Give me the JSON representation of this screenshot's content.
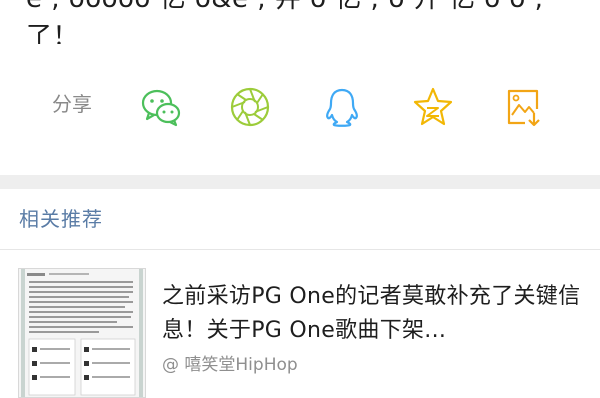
{
  "article_text": {
    "line1": "e , ooooo 亿 o&e , 井 o 亿 ; o 开 亿 o o ,",
    "line2": "了！"
  },
  "share": {
    "label": "分享",
    "buttons": [
      {
        "name": "wechat",
        "icon": "wechat-icon",
        "color": "#4cbf5b"
      },
      {
        "name": "moments",
        "icon": "moments-icon",
        "color": "#9ccc3a"
      },
      {
        "name": "qq",
        "icon": "qq-icon",
        "color": "#3fa9f5"
      },
      {
        "name": "qzone",
        "icon": "qzone-icon",
        "color": "#f2b705"
      },
      {
        "name": "save-image",
        "icon": "save-image-icon",
        "color": "#f2a515"
      }
    ]
  },
  "related": {
    "title": "相关推荐",
    "title_color": "#5a7ca6",
    "items": [
      {
        "title": "之前采访PG One的记者莫敢补充了关键信息！关于PG One歌曲下架...",
        "source": "@ 嘻笑堂HipHop"
      }
    ]
  }
}
